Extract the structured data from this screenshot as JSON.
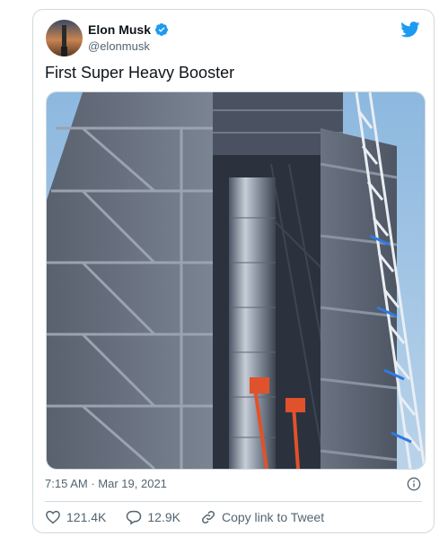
{
  "tweet": {
    "author_name": "Elon Musk",
    "author_handle": "@elonmusk",
    "text": "First Super Heavy Booster",
    "time": "7:15 AM",
    "separator": "·",
    "date": "Mar 19, 2021"
  },
  "actions": {
    "likes": "121.4K",
    "replies": "12.9K",
    "share_label": "Copy link to Tweet"
  },
  "colors": {
    "brand": "#1d9bf0",
    "text_secondary": "#536471",
    "border": "#cfd9de"
  },
  "icons": [
    "verified-badge-icon",
    "twitter-bird-icon",
    "info-icon",
    "heart-icon",
    "reply-icon",
    "link-icon"
  ]
}
